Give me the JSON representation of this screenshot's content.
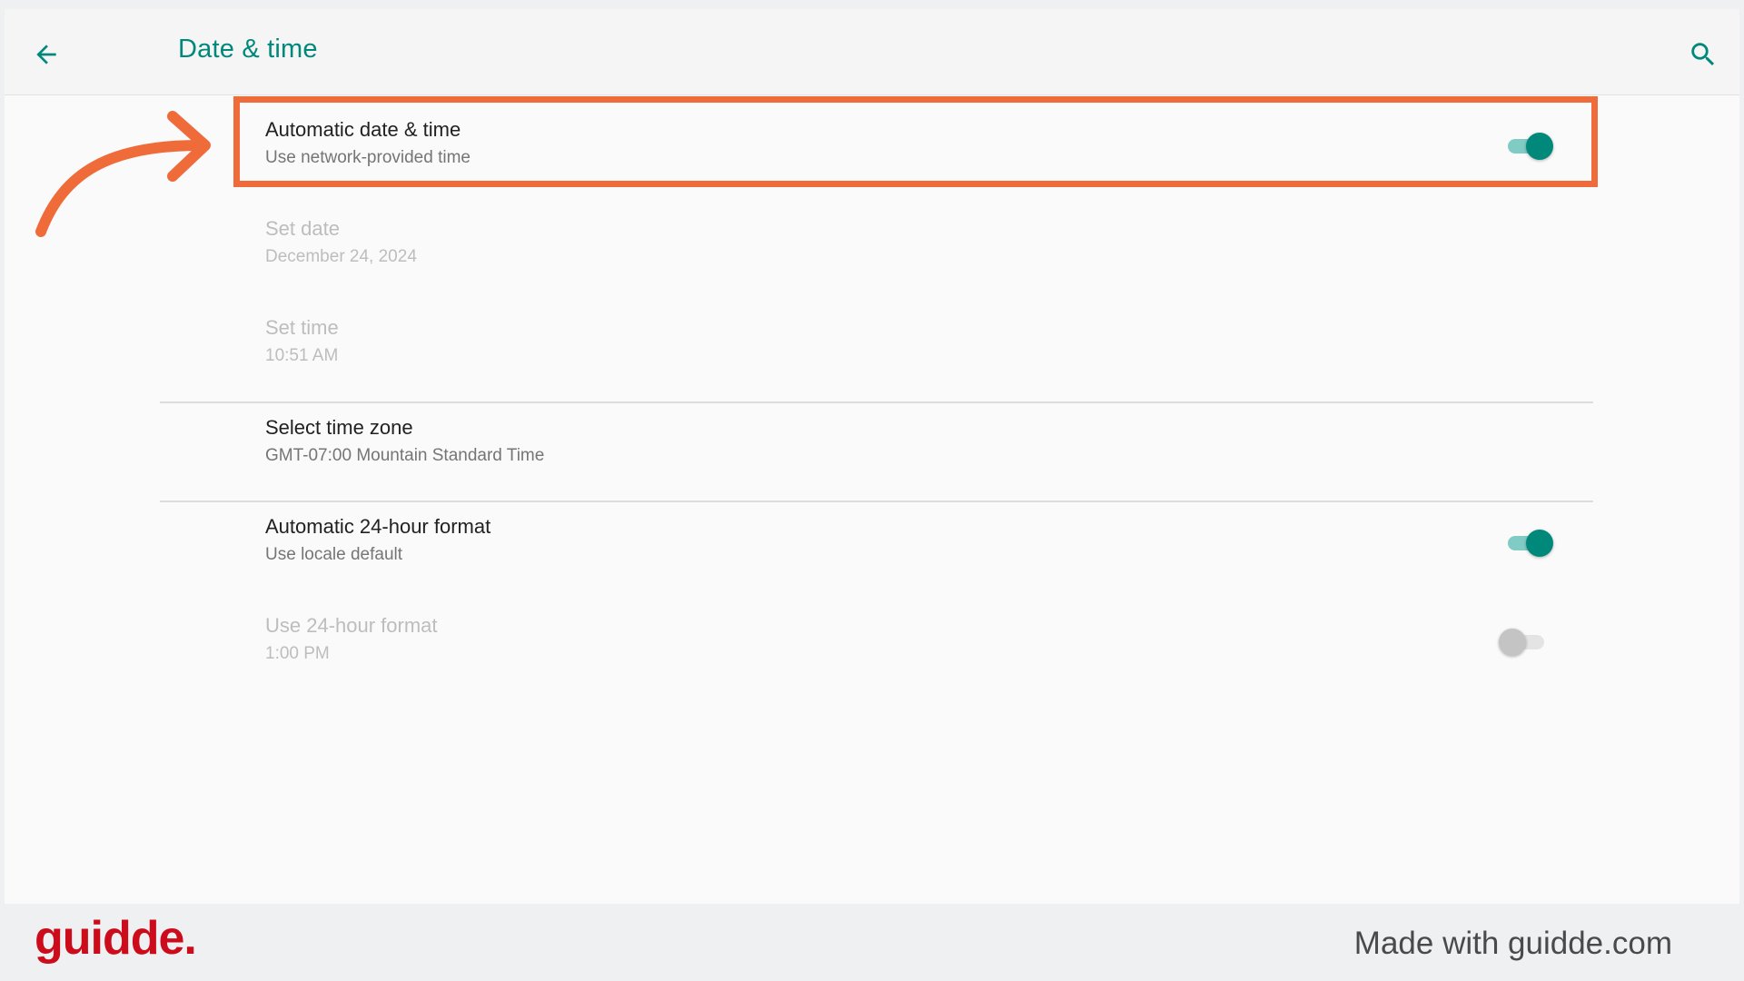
{
  "app_bar": {
    "title": "Date & time",
    "back_icon": "arrow-back-icon",
    "search_icon": "search-icon"
  },
  "settings": [
    {
      "primary": "Automatic date & time",
      "secondary": "Use network-provided time",
      "enabled": true,
      "toggle": true,
      "toggle_on": true
    },
    {
      "primary": "Set date",
      "secondary": "December 24, 2024",
      "enabled": false,
      "toggle": false
    },
    {
      "primary": "Set time",
      "secondary": "10:51 AM",
      "enabled": false,
      "toggle": false
    },
    {
      "primary": "Select time zone",
      "secondary": "GMT-07:00 Mountain Standard Time",
      "enabled": true,
      "toggle": false
    },
    {
      "primary": "Automatic 24-hour format",
      "secondary": "Use locale default",
      "enabled": true,
      "toggle": true,
      "toggle_on": true
    },
    {
      "primary": "Use 24-hour format",
      "secondary": "1:00 PM",
      "enabled": false,
      "toggle": true,
      "toggle_on": false
    }
  ],
  "colors": {
    "accent": "#00897b",
    "highlight": "#ef6b3a",
    "brand": "#cc0b1b"
  },
  "footer": {
    "brand": "guidde.",
    "made_with": "Made with guidde.com"
  }
}
